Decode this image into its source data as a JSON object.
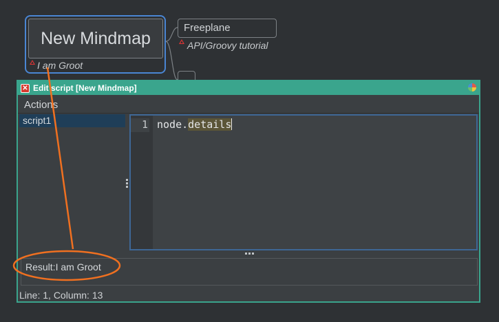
{
  "mindmap": {
    "root_title": "New Mindmap",
    "root_detail": "I am Groot",
    "child_title": "Freeplane",
    "child_detail": "API/Groovy tutorial"
  },
  "dialog": {
    "title": "Edit script [New Mindmap]",
    "menu_actions": "Actions",
    "scripts": [
      "script1"
    ],
    "editor": {
      "line_number": "1",
      "code_plain": "node.",
      "code_highlight": "details"
    },
    "result": "Result:I am Groot",
    "status": "Line: 1, Column: 13"
  },
  "colors": {
    "accent": "#3aa58d",
    "annotation": "#f07020",
    "selection": "#4a86d4"
  }
}
